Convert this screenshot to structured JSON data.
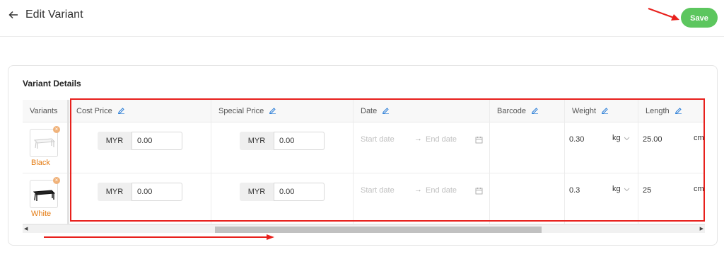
{
  "header": {
    "title": "Edit Variant",
    "save_label": "Save"
  },
  "card": {
    "title": "Variant Details"
  },
  "table": {
    "headers": {
      "variants": "Variants",
      "cost_price": "Cost Price",
      "special_price": "Special Price",
      "date": "Date",
      "barcode": "Barcode",
      "weight": "Weight",
      "length": "Length"
    },
    "rows": [
      {
        "variant": "Black",
        "cost_currency": "MYR",
        "cost_price": "0.00",
        "special_currency": "MYR",
        "special_price": "0.00",
        "start_date": "Start date",
        "end_date": "End date",
        "barcode": "",
        "weight": "0.30",
        "weight_unit": "kg",
        "length": "25.00",
        "length_unit": "cm"
      },
      {
        "variant": "White",
        "cost_currency": "MYR",
        "cost_price": "0.00",
        "special_currency": "MYR",
        "special_price": "0.00",
        "start_date": "Start date",
        "end_date": "End date",
        "barcode": "",
        "weight": "0.3",
        "weight_unit": "kg",
        "length": "25",
        "length_unit": "cm"
      }
    ]
  },
  "icons": {
    "back": "arrow-left-icon",
    "edit": "pencil-icon",
    "calendar": "calendar-icon",
    "chevron": "chevron-down-icon",
    "remove": "close-icon"
  },
  "colors": {
    "save_button": "#5cc65e",
    "variant_label": "#e47b12",
    "annotation": "#e8201c",
    "edit_icon": "#2d7fd8"
  }
}
